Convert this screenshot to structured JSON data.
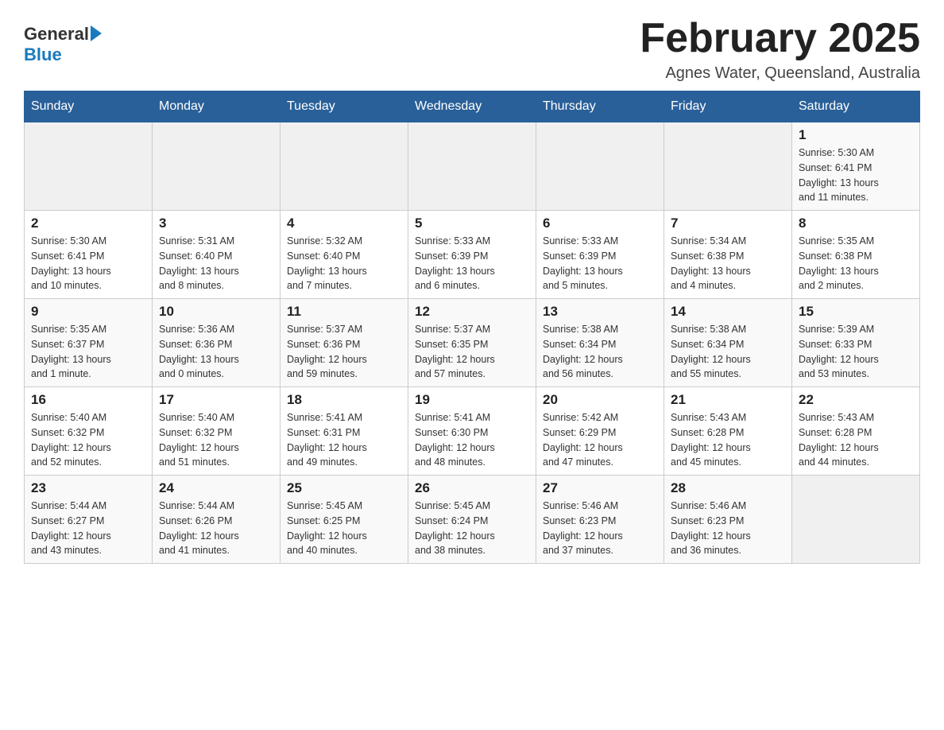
{
  "header": {
    "logo_general": "General",
    "logo_blue": "Blue",
    "month_title": "February 2025",
    "location": "Agnes Water, Queensland, Australia"
  },
  "days_of_week": [
    "Sunday",
    "Monday",
    "Tuesday",
    "Wednesday",
    "Thursday",
    "Friday",
    "Saturday"
  ],
  "weeks": [
    [
      {
        "day": "",
        "info": ""
      },
      {
        "day": "",
        "info": ""
      },
      {
        "day": "",
        "info": ""
      },
      {
        "day": "",
        "info": ""
      },
      {
        "day": "",
        "info": ""
      },
      {
        "day": "",
        "info": ""
      },
      {
        "day": "1",
        "info": "Sunrise: 5:30 AM\nSunset: 6:41 PM\nDaylight: 13 hours\nand 11 minutes."
      }
    ],
    [
      {
        "day": "2",
        "info": "Sunrise: 5:30 AM\nSunset: 6:41 PM\nDaylight: 13 hours\nand 10 minutes."
      },
      {
        "day": "3",
        "info": "Sunrise: 5:31 AM\nSunset: 6:40 PM\nDaylight: 13 hours\nand 8 minutes."
      },
      {
        "day": "4",
        "info": "Sunrise: 5:32 AM\nSunset: 6:40 PM\nDaylight: 13 hours\nand 7 minutes."
      },
      {
        "day": "5",
        "info": "Sunrise: 5:33 AM\nSunset: 6:39 PM\nDaylight: 13 hours\nand 6 minutes."
      },
      {
        "day": "6",
        "info": "Sunrise: 5:33 AM\nSunset: 6:39 PM\nDaylight: 13 hours\nand 5 minutes."
      },
      {
        "day": "7",
        "info": "Sunrise: 5:34 AM\nSunset: 6:38 PM\nDaylight: 13 hours\nand 4 minutes."
      },
      {
        "day": "8",
        "info": "Sunrise: 5:35 AM\nSunset: 6:38 PM\nDaylight: 13 hours\nand 2 minutes."
      }
    ],
    [
      {
        "day": "9",
        "info": "Sunrise: 5:35 AM\nSunset: 6:37 PM\nDaylight: 13 hours\nand 1 minute."
      },
      {
        "day": "10",
        "info": "Sunrise: 5:36 AM\nSunset: 6:36 PM\nDaylight: 13 hours\nand 0 minutes."
      },
      {
        "day": "11",
        "info": "Sunrise: 5:37 AM\nSunset: 6:36 PM\nDaylight: 12 hours\nand 59 minutes."
      },
      {
        "day": "12",
        "info": "Sunrise: 5:37 AM\nSunset: 6:35 PM\nDaylight: 12 hours\nand 57 minutes."
      },
      {
        "day": "13",
        "info": "Sunrise: 5:38 AM\nSunset: 6:34 PM\nDaylight: 12 hours\nand 56 minutes."
      },
      {
        "day": "14",
        "info": "Sunrise: 5:38 AM\nSunset: 6:34 PM\nDaylight: 12 hours\nand 55 minutes."
      },
      {
        "day": "15",
        "info": "Sunrise: 5:39 AM\nSunset: 6:33 PM\nDaylight: 12 hours\nand 53 minutes."
      }
    ],
    [
      {
        "day": "16",
        "info": "Sunrise: 5:40 AM\nSunset: 6:32 PM\nDaylight: 12 hours\nand 52 minutes."
      },
      {
        "day": "17",
        "info": "Sunrise: 5:40 AM\nSunset: 6:32 PM\nDaylight: 12 hours\nand 51 minutes."
      },
      {
        "day": "18",
        "info": "Sunrise: 5:41 AM\nSunset: 6:31 PM\nDaylight: 12 hours\nand 49 minutes."
      },
      {
        "day": "19",
        "info": "Sunrise: 5:41 AM\nSunset: 6:30 PM\nDaylight: 12 hours\nand 48 minutes."
      },
      {
        "day": "20",
        "info": "Sunrise: 5:42 AM\nSunset: 6:29 PM\nDaylight: 12 hours\nand 47 minutes."
      },
      {
        "day": "21",
        "info": "Sunrise: 5:43 AM\nSunset: 6:28 PM\nDaylight: 12 hours\nand 45 minutes."
      },
      {
        "day": "22",
        "info": "Sunrise: 5:43 AM\nSunset: 6:28 PM\nDaylight: 12 hours\nand 44 minutes."
      }
    ],
    [
      {
        "day": "23",
        "info": "Sunrise: 5:44 AM\nSunset: 6:27 PM\nDaylight: 12 hours\nand 43 minutes."
      },
      {
        "day": "24",
        "info": "Sunrise: 5:44 AM\nSunset: 6:26 PM\nDaylight: 12 hours\nand 41 minutes."
      },
      {
        "day": "25",
        "info": "Sunrise: 5:45 AM\nSunset: 6:25 PM\nDaylight: 12 hours\nand 40 minutes."
      },
      {
        "day": "26",
        "info": "Sunrise: 5:45 AM\nSunset: 6:24 PM\nDaylight: 12 hours\nand 38 minutes."
      },
      {
        "day": "27",
        "info": "Sunrise: 5:46 AM\nSunset: 6:23 PM\nDaylight: 12 hours\nand 37 minutes."
      },
      {
        "day": "28",
        "info": "Sunrise: 5:46 AM\nSunset: 6:23 PM\nDaylight: 12 hours\nand 36 minutes."
      },
      {
        "day": "",
        "info": ""
      }
    ]
  ]
}
